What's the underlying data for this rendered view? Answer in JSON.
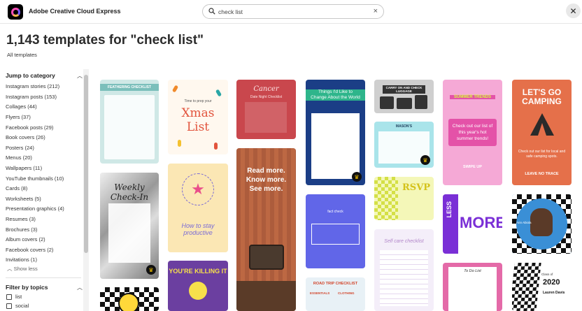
{
  "header": {
    "app_title": "Adobe Creative Cloud Express",
    "search_value": "check list",
    "search_placeholder": "Search",
    "clear_glyph": "×",
    "close_glyph": "✕"
  },
  "main": {
    "title": "1,143 templates for \"check list\"",
    "breadcrumb": "All templates"
  },
  "sidebar": {
    "jump_heading": "Jump to category",
    "categories": [
      "Instagram stories (212)",
      "Instagram posts (153)",
      "Collages (44)",
      "Flyers (37)",
      "Facebook posts (29)",
      "Book covers (26)",
      "Posters (24)",
      "Menus (20)",
      "Wallpapers (11)",
      "YouTube thumbnails (10)",
      "Cards (8)",
      "Worksheets (5)",
      "Presentation graphics (4)",
      "Resumes (3)",
      "Brochures (3)",
      "Album covers (2)",
      "Facebook covers (2)",
      "Invitations (1)"
    ],
    "show_less": "Show less",
    "filter_heading": "Filter by topics",
    "topics": [
      "list",
      "social"
    ]
  },
  "templates": {
    "c1": {
      "title": "FEATHERING CHECKLIST"
    },
    "c2": {
      "line1": "Time to prep your",
      "line2": "Xmas",
      "line3": "List"
    },
    "c3": {
      "title": "Cancer",
      "subtitle": "Date Night Checklist"
    },
    "c4": {
      "title": "Read more. Know more. See more."
    },
    "c5": {
      "title": "Things I'd Like to Change About the World"
    },
    "c6": {
      "title": "fact check"
    },
    "c7": {
      "title": "ROAD TRIP CHECKLIST",
      "col1": "ESSENTIALS",
      "col2": "CLOTHING"
    },
    "c8": {
      "title": "CARRY ON AND CHECK LUGGAGE"
    },
    "c9": {
      "title": "MASON'S"
    },
    "c10": {
      "title": "RSVP"
    },
    "c11": {
      "title": "Self care checklist"
    },
    "c12": {
      "title": "SUMMER TRENDS",
      "body": "Check out our list of this year's hot summer trends!",
      "cta": "SWIPE UP"
    },
    "c13": {
      "word1": "LESS",
      "word2": "MORE"
    },
    "c14": {
      "title": "To Do List"
    },
    "c15": {
      "title": "LET'S GO CAMPING",
      "body": "Check out our list for local and safe camping spots.",
      "footer": "LEAVE NO TRACE"
    },
    "c16": {
      "caption": "Ann Abiola"
    },
    "c17": {
      "label": "Class of",
      "year": "2020",
      "name": "Lauren Davis"
    },
    "c18": {
      "title": "Weekly Check-In"
    },
    "c19": {
      "title": "How to stay productive"
    },
    "c20": {
      "title": "YOU'RE KILLING IT"
    }
  },
  "colors": {
    "brand_black": "#000000",
    "accent_pink": "#ff4fb8",
    "premium_crown": "#f5c400"
  }
}
